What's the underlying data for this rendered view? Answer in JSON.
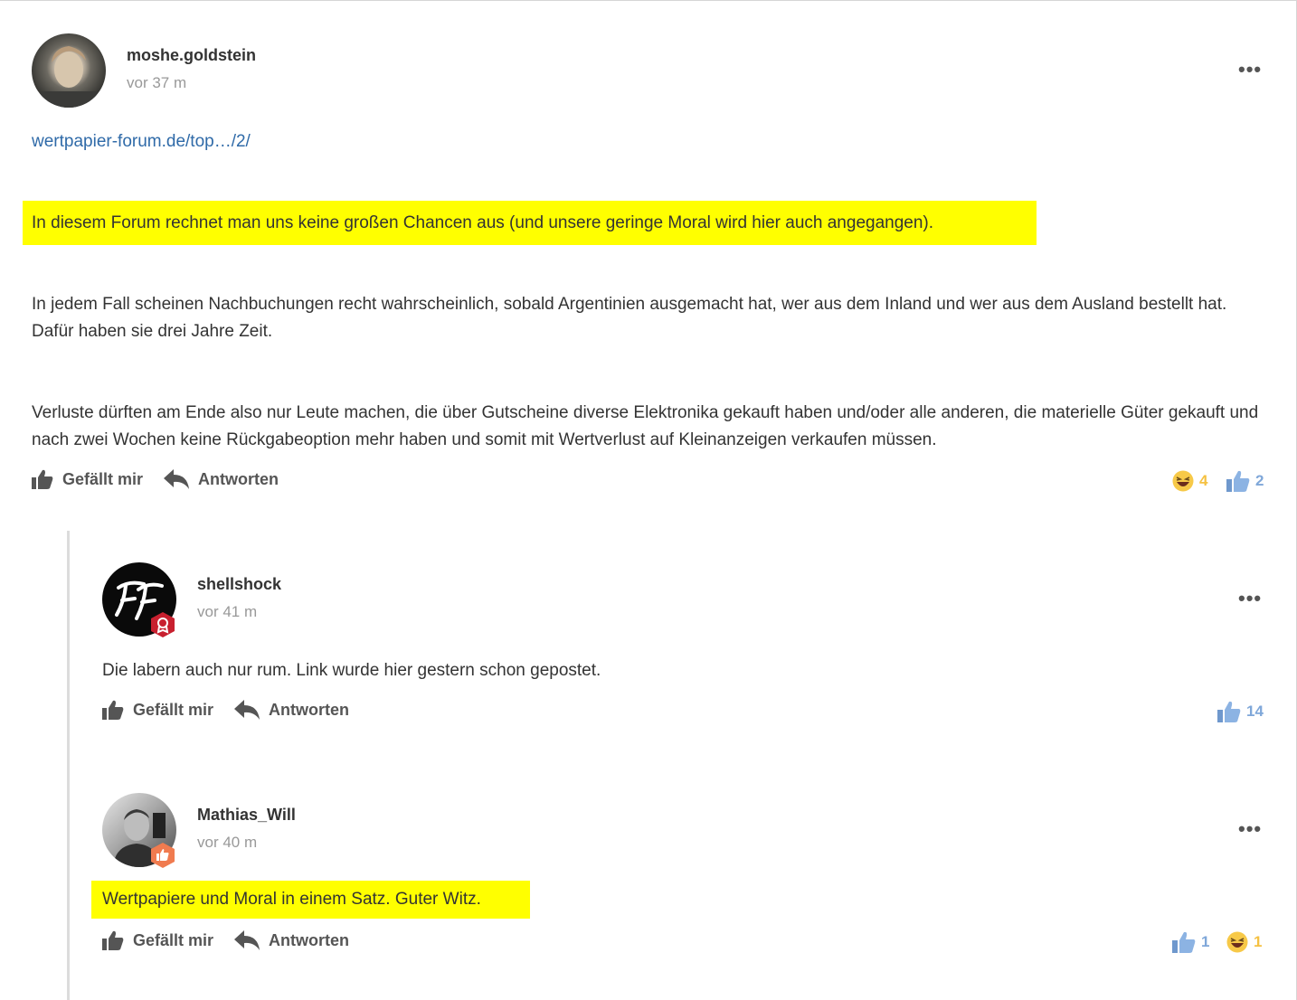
{
  "posts": [
    {
      "author": "moshe.goldstein",
      "time": "vor 37 m",
      "more": "•••",
      "link": "wertpapier-forum.de/top…/2/",
      "highlight": "In diesem Forum rechnet man uns keine großen Chancen aus (und unsere geringe Moral wird hier auch angegangen).",
      "paragraph1": "In jedem Fall scheinen Nachbuchungen recht wahrscheinlich, sobald Argentinien ausgemacht hat, wer aus dem Inland und wer aus dem Ausland bestellt hat. Dafür haben sie drei Jahre Zeit.",
      "paragraph2": "Verluste dürften am Ende also nur Leute machen, die über Gutscheine diverse Elektronika gekauft haben und/oder alle anderen, die materielle Güter gekauft und nach zwei Wochen keine Rückgabeoption mehr haben und somit mit Wertverlust auf Kleinanzeigen verkaufen müssen.",
      "like_label": "Gefällt mir",
      "reply_label": "Antworten",
      "reactions": {
        "haha": "4",
        "like": "2"
      }
    },
    {
      "author": "shellshock",
      "time": "vor 41 m",
      "more": "•••",
      "body": "Die labern auch nur rum. Link wurde hier gestern schon gepostet.",
      "like_label": "Gefällt mir",
      "reply_label": "Antworten",
      "reactions": {
        "like": "14"
      }
    },
    {
      "author": "Mathias_Will",
      "time": "vor 40 m",
      "more": "•••",
      "highlight": "Wertpapiere und Moral in einem Satz. Guter Witz.",
      "like_label": "Gefällt mir",
      "reply_label": "Antworten",
      "reactions": {
        "like": "1",
        "haha": "1"
      }
    }
  ],
  "colors": {
    "highlight": "#ffff00",
    "link": "#2f6aa8",
    "like_blue": "#7fa7d9",
    "haha_yellow": "#f5c142",
    "badge_red": "#c8202f",
    "badge_orange": "#f07b4f"
  }
}
